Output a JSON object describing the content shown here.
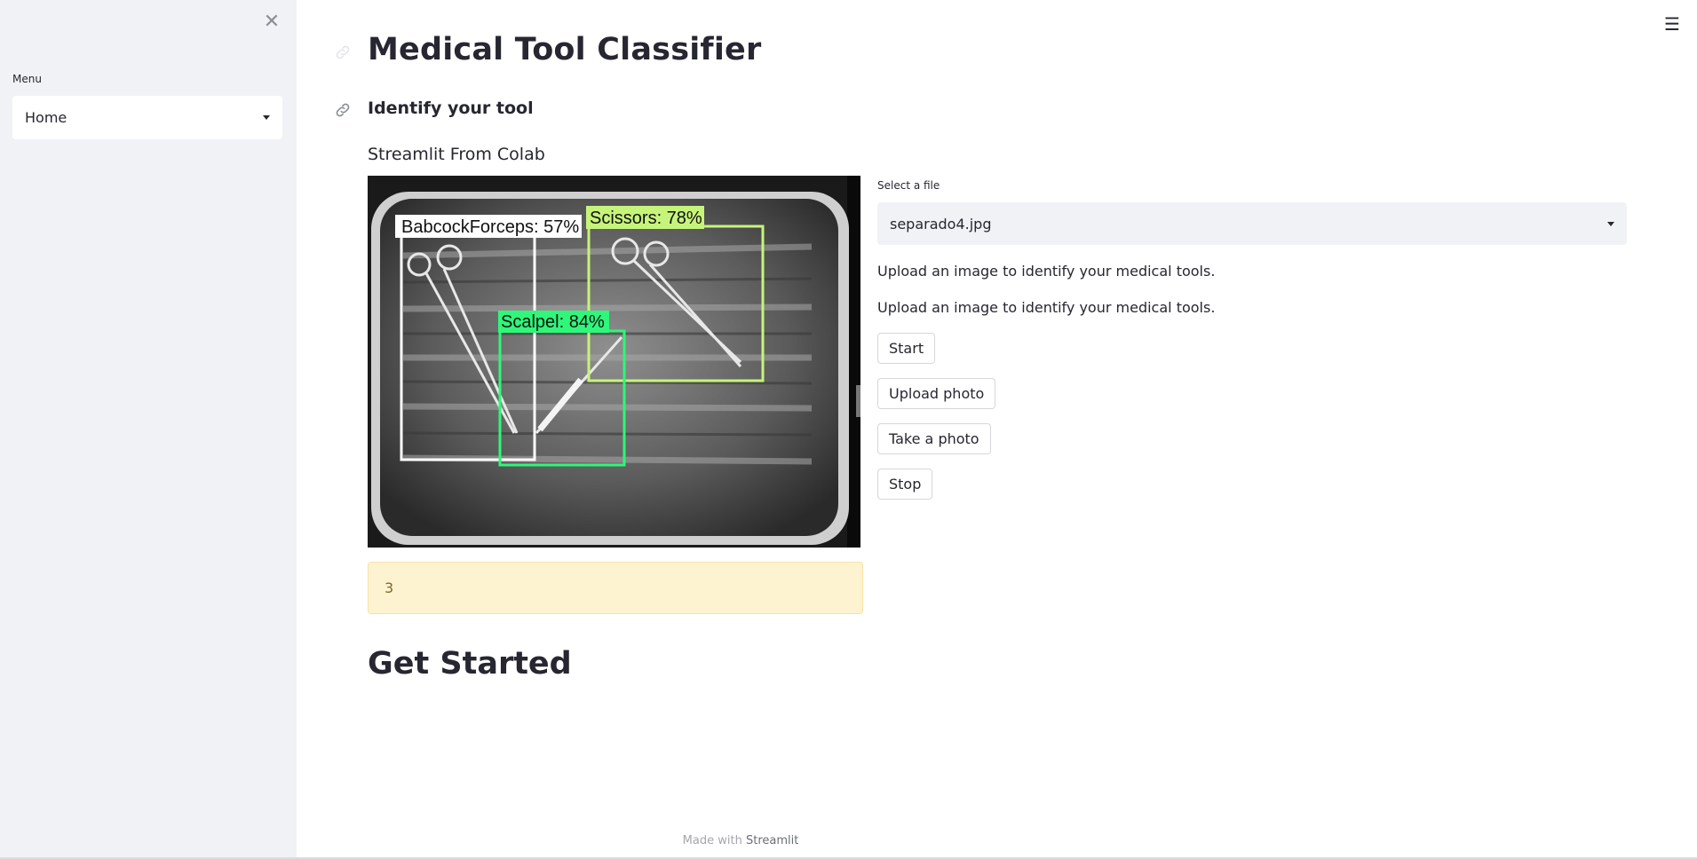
{
  "sidebar": {
    "close_icon": "close-icon",
    "menu_label": "Menu",
    "menu_selected": "Home"
  },
  "header": {
    "menu_icon": "hamburger-icon"
  },
  "main": {
    "title": "Medical Tool Classifier",
    "subtitle": "Identify your tool",
    "section_text": "Streamlit From Colab",
    "detections": [
      {
        "label": "BabcockForceps: 57%",
        "color": "#ffffff"
      },
      {
        "label": "Scissors: 78%",
        "color": "#c6f47a"
      },
      {
        "label": "Scalpel: 84%",
        "color": "#2ef77a"
      }
    ],
    "info_value": "3",
    "get_started": "Get Started"
  },
  "right": {
    "file_label": "Select a file",
    "file_selected": "separado4.jpg",
    "desc_1": "Upload an image to identify your medical tools.",
    "desc_2": "Upload an image to identify your medical tools.",
    "buttons": {
      "start": "Start",
      "upload": "Upload photo",
      "take": "Take a photo",
      "stop": "Stop"
    }
  },
  "footer": {
    "prefix": "Made with",
    "brand": "Streamlit"
  },
  "colors": {
    "sidebar_bg": "#f0f2f6",
    "info_bg": "#fdf3d1",
    "text": "#262730"
  }
}
